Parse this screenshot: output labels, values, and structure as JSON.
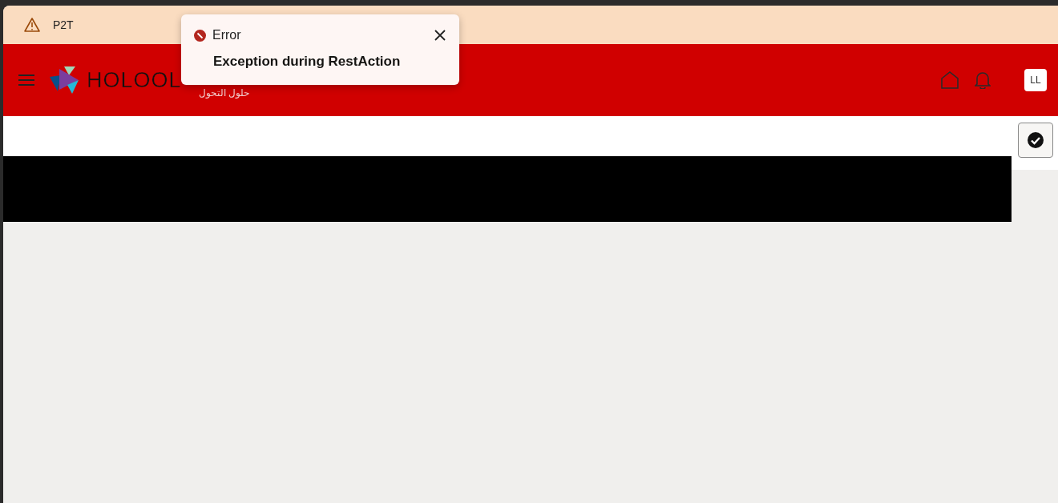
{
  "banner": {
    "text": "P2T"
  },
  "header": {
    "logo_text": "HOLOOL",
    "logo_subtitle": "حلول التحول",
    "avatar": "LL"
  },
  "toast": {
    "title": "Error",
    "message": "Exception during RestAction"
  },
  "action_button": {
    "checked": true
  }
}
